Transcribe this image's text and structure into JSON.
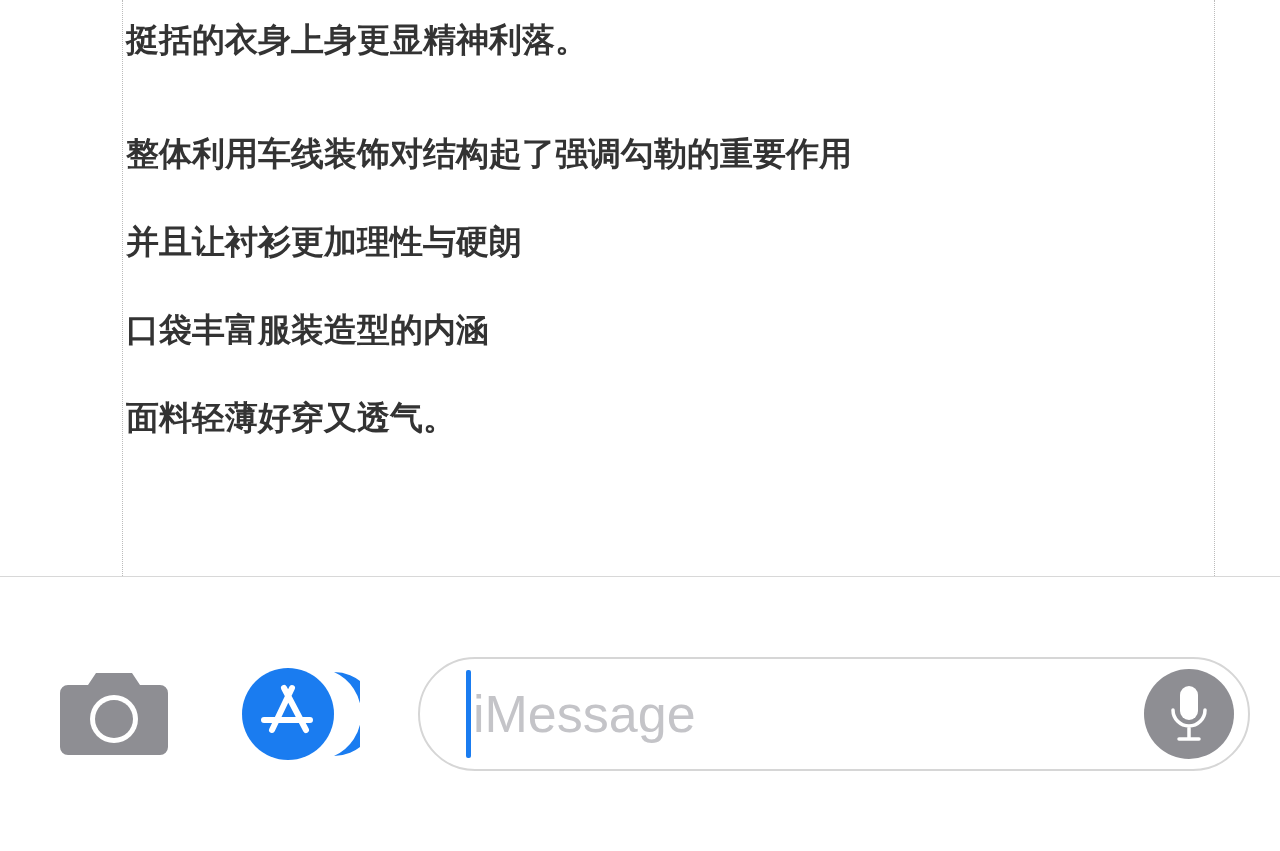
{
  "article": {
    "paragraphs": [
      {
        "lines": [
          "挺括的衣身上身更显精神利落。"
        ]
      },
      {
        "lines": [
          "整体利用车线装饰对结构起了强调勾勒的重要作用",
          "并且让衬衫更加理性与硬朗",
          "口袋丰富服装造型的内涵",
          "面料轻薄好穿又透气。"
        ]
      }
    ]
  },
  "composer": {
    "placeholder": "iMessage"
  }
}
